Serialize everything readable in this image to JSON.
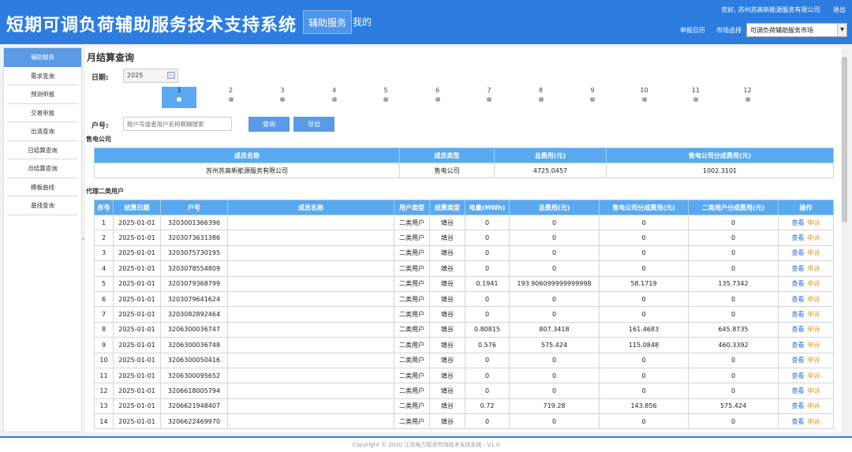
{
  "header": {
    "app_title": "短期可调负荷辅助服务技术支持系统",
    "nav_tabs": [
      {
        "label": "辅助服务"
      },
      {
        "label": "我的"
      }
    ],
    "greeting": "您好, 苏州苏高新能源服务有限公司",
    "logout": "退出",
    "calendar_link": "申报日历",
    "market_label": "市场选择",
    "market_value": "可调负荷辅助服务市场"
  },
  "sidebar": {
    "items": [
      {
        "label": "辅助服务"
      },
      {
        "label": "需求查询"
      },
      {
        "label": "预测申报"
      },
      {
        "label": "交易申报"
      },
      {
        "label": "出清查询"
      },
      {
        "label": "日结算查询"
      },
      {
        "label": "月结算查询"
      },
      {
        "label": "模板曲线"
      },
      {
        "label": "基线查询"
      }
    ]
  },
  "main": {
    "page_title": "月结算查询",
    "date_label": "日期:",
    "year": "2025",
    "months": [
      "1",
      "2",
      "3",
      "4",
      "5",
      "6",
      "7",
      "8",
      "9",
      "10",
      "11",
      "12"
    ],
    "month_marker": "!",
    "account_label": "户号:",
    "search_placeholder": "按户号或者用户名称模糊搜索",
    "query_button": "查询",
    "export_button": "导出",
    "company_section": "售电公司",
    "company_headers": [
      "成员名称",
      "成员类型",
      "总费用(元)",
      "售电公司分成费用(元)"
    ],
    "company_row": [
      "苏州苏高新能源服务有限公司",
      "售电公司",
      "4725.0457",
      "1002.3101"
    ],
    "users_section": "代理二类用户",
    "user_headers": [
      "序号",
      "结算日期",
      "户号",
      "成员名称",
      "用户类型",
      "结算类型",
      "电量(MWh)",
      "总费用(元)",
      "售电公司分成费用(元)",
      "二类用户分成费用(元)",
      "操作"
    ],
    "action_view": "查看",
    "action_appeal": "申诉",
    "rows": [
      [
        "1",
        "2025-01-01",
        "3203001366396",
        "",
        "二类用户",
        "填谷",
        "0",
        "0",
        "0",
        "0"
      ],
      [
        "2",
        "2025-01-01",
        "3203073631386",
        "",
        "二类用户",
        "填谷",
        "0",
        "0",
        "0",
        "0"
      ],
      [
        "3",
        "2025-01-01",
        "3203075730195",
        "",
        "二类用户",
        "填谷",
        "0",
        "0",
        "0",
        "0"
      ],
      [
        "4",
        "2025-01-01",
        "3203078554809",
        "",
        "二类用户",
        "填谷",
        "0",
        "0",
        "0",
        "0"
      ],
      [
        "5",
        "2025-01-01",
        "3203079368799",
        "",
        "二类用户",
        "填谷",
        "0.1941",
        "193.906099999999998",
        "58.1719",
        "135.7342"
      ],
      [
        "6",
        "2025-01-01",
        "3203079641624",
        "",
        "二类用户",
        "填谷",
        "0",
        "0",
        "0",
        "0"
      ],
      [
        "7",
        "2025-01-01",
        "3203082892464",
        "",
        "二类用户",
        "填谷",
        "0",
        "0",
        "0",
        "0"
      ],
      [
        "8",
        "2025-01-01",
        "3206300036747",
        "",
        "二类用户",
        "填谷",
        "0.80815",
        "807.3418",
        "161.4683",
        "645.8735"
      ],
      [
        "9",
        "2025-01-01",
        "3206300036748",
        "",
        "二类用户",
        "填谷",
        "0.576",
        "575.424",
        "115.0848",
        "460.3392"
      ],
      [
        "10",
        "2025-01-01",
        "3206300050416",
        "",
        "二类用户",
        "填谷",
        "0",
        "0",
        "0",
        "0"
      ],
      [
        "11",
        "2025-01-01",
        "3206300095652",
        "",
        "二类用户",
        "填谷",
        "0",
        "0",
        "0",
        "0"
      ],
      [
        "12",
        "2025-01-01",
        "3206618005794",
        "",
        "二类用户",
        "填谷",
        "0",
        "0",
        "0",
        "0"
      ],
      [
        "13",
        "2025-01-01",
        "3206621948407",
        "",
        "二类用户",
        "填谷",
        "0.72",
        "719.28",
        "143.856",
        "575.424"
      ],
      [
        "14",
        "2025-01-01",
        "3206622469970",
        "",
        "二类用户",
        "填谷",
        "0",
        "0",
        "0",
        "0"
      ]
    ]
  },
  "footer": {
    "copyright": "Copyright © 2020 江苏电力现货市场技术支持系统 - V1.0"
  }
}
